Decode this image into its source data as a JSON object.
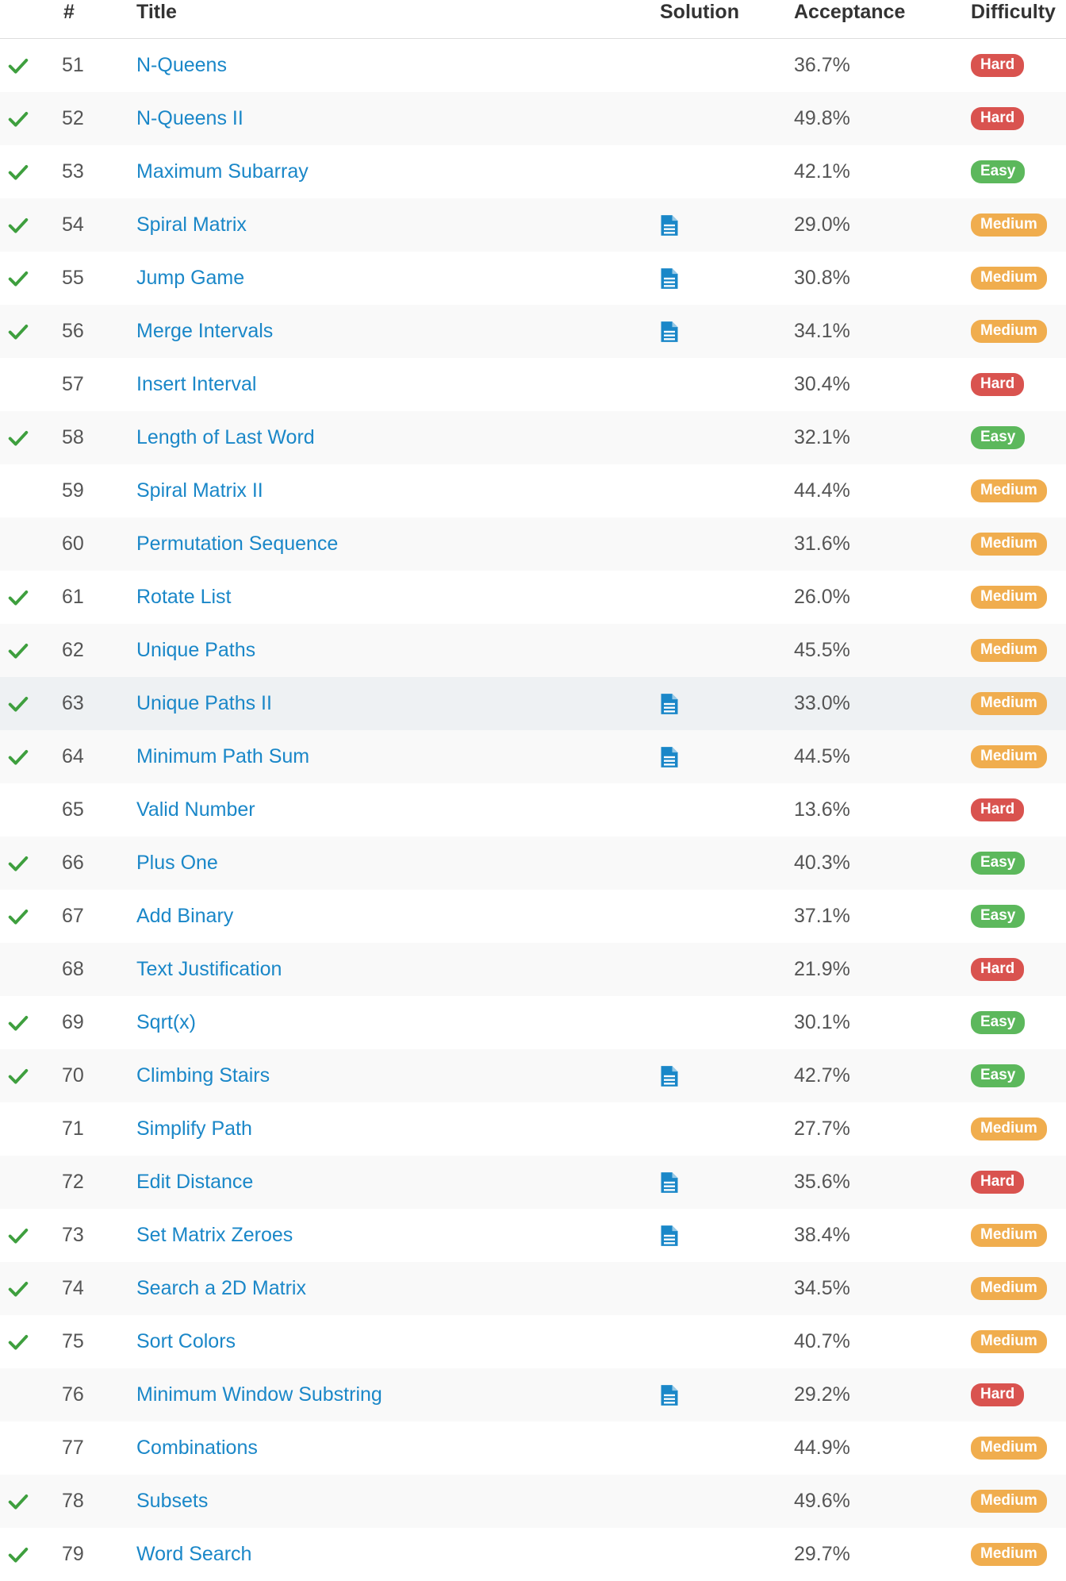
{
  "colors": {
    "link": "#1a87c8",
    "check": "#3e9f3e",
    "solution_icon": "#1a87c8",
    "hard": "#d9534f",
    "easy": "#5cb85c",
    "medium": "#f0ad4e"
  },
  "headers": {
    "num": "#",
    "title": "Title",
    "solution": "Solution",
    "acceptance": "Acceptance",
    "difficulty": "Difficulty"
  },
  "rows": [
    {
      "solved": true,
      "num": "51",
      "title": "N-Queens",
      "solution": false,
      "acceptance": "36.7%",
      "difficulty": "Hard"
    },
    {
      "solved": true,
      "num": "52",
      "title": "N-Queens II",
      "solution": false,
      "acceptance": "49.8%",
      "difficulty": "Hard"
    },
    {
      "solved": true,
      "num": "53",
      "title": "Maximum Subarray",
      "solution": false,
      "acceptance": "42.1%",
      "difficulty": "Easy"
    },
    {
      "solved": true,
      "num": "54",
      "title": "Spiral Matrix",
      "solution": true,
      "acceptance": "29.0%",
      "difficulty": "Medium"
    },
    {
      "solved": true,
      "num": "55",
      "title": "Jump Game",
      "solution": true,
      "acceptance": "30.8%",
      "difficulty": "Medium"
    },
    {
      "solved": true,
      "num": "56",
      "title": "Merge Intervals",
      "solution": true,
      "acceptance": "34.1%",
      "difficulty": "Medium"
    },
    {
      "solved": false,
      "num": "57",
      "title": "Insert Interval",
      "solution": false,
      "acceptance": "30.4%",
      "difficulty": "Hard"
    },
    {
      "solved": true,
      "num": "58",
      "title": "Length of Last Word",
      "solution": false,
      "acceptance": "32.1%",
      "difficulty": "Easy"
    },
    {
      "solved": false,
      "num": "59",
      "title": "Spiral Matrix II",
      "solution": false,
      "acceptance": "44.4%",
      "difficulty": "Medium"
    },
    {
      "solved": false,
      "num": "60",
      "title": "Permutation Sequence",
      "solution": false,
      "acceptance": "31.6%",
      "difficulty": "Medium"
    },
    {
      "solved": true,
      "num": "61",
      "title": "Rotate List",
      "solution": false,
      "acceptance": "26.0%",
      "difficulty": "Medium"
    },
    {
      "solved": true,
      "num": "62",
      "title": "Unique Paths",
      "solution": false,
      "acceptance": "45.5%",
      "difficulty": "Medium"
    },
    {
      "solved": true,
      "num": "63",
      "title": "Unique Paths II",
      "solution": true,
      "acceptance": "33.0%",
      "difficulty": "Medium",
      "hover": true
    },
    {
      "solved": true,
      "num": "64",
      "title": "Minimum Path Sum",
      "solution": true,
      "acceptance": "44.5%",
      "difficulty": "Medium"
    },
    {
      "solved": false,
      "num": "65",
      "title": "Valid Number",
      "solution": false,
      "acceptance": "13.6%",
      "difficulty": "Hard"
    },
    {
      "solved": true,
      "num": "66",
      "title": "Plus One",
      "solution": false,
      "acceptance": "40.3%",
      "difficulty": "Easy"
    },
    {
      "solved": true,
      "num": "67",
      "title": "Add Binary",
      "solution": false,
      "acceptance": "37.1%",
      "difficulty": "Easy"
    },
    {
      "solved": false,
      "num": "68",
      "title": "Text Justification",
      "solution": false,
      "acceptance": "21.9%",
      "difficulty": "Hard"
    },
    {
      "solved": true,
      "num": "69",
      "title": "Sqrt(x)",
      "solution": false,
      "acceptance": "30.1%",
      "difficulty": "Easy"
    },
    {
      "solved": true,
      "num": "70",
      "title": "Climbing Stairs",
      "solution": true,
      "acceptance": "42.7%",
      "difficulty": "Easy"
    },
    {
      "solved": false,
      "num": "71",
      "title": "Simplify Path",
      "solution": false,
      "acceptance": "27.7%",
      "difficulty": "Medium"
    },
    {
      "solved": false,
      "num": "72",
      "title": "Edit Distance",
      "solution": true,
      "acceptance": "35.6%",
      "difficulty": "Hard"
    },
    {
      "solved": true,
      "num": "73",
      "title": "Set Matrix Zeroes",
      "solution": true,
      "acceptance": "38.4%",
      "difficulty": "Medium"
    },
    {
      "solved": true,
      "num": "74",
      "title": "Search a 2D Matrix",
      "solution": false,
      "acceptance": "34.5%",
      "difficulty": "Medium"
    },
    {
      "solved": true,
      "num": "75",
      "title": "Sort Colors",
      "solution": false,
      "acceptance": "40.7%",
      "difficulty": "Medium"
    },
    {
      "solved": false,
      "num": "76",
      "title": "Minimum Window Substring",
      "solution": true,
      "acceptance": "29.2%",
      "difficulty": "Hard"
    },
    {
      "solved": false,
      "num": "77",
      "title": "Combinations",
      "solution": false,
      "acceptance": "44.9%",
      "difficulty": "Medium"
    },
    {
      "solved": true,
      "num": "78",
      "title": "Subsets",
      "solution": false,
      "acceptance": "49.6%",
      "difficulty": "Medium"
    },
    {
      "solved": true,
      "num": "79",
      "title": "Word Search",
      "solution": false,
      "acceptance": "29.7%",
      "difficulty": "Medium"
    }
  ]
}
